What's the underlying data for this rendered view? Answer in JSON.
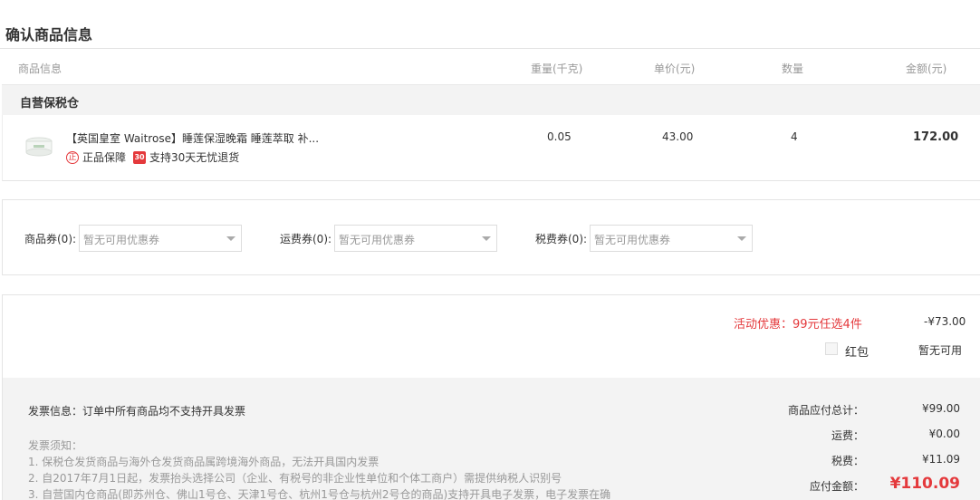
{
  "page": {
    "title": "确认商品信息"
  },
  "table": {
    "headers": {
      "info": "商品信息",
      "weight": "重量(千克)",
      "price": "单价(元)",
      "qty": "数量",
      "amount": "金额(元)"
    },
    "warehouse": "自营保税仓",
    "product": {
      "name": "【英国皇室 Waitrose】睡莲保湿晚霜 睡莲萃取 补...",
      "guarantee": "正品保障",
      "return_badge": "30",
      "return_policy": "支持30天无忧退货",
      "weight": "0.05",
      "price": "43.00",
      "qty": "4",
      "amount": "172.00"
    }
  },
  "coupons": {
    "goods": {
      "label": "商品券(0):",
      "placeholder": "暂无可用优惠券"
    },
    "shipping": {
      "label": "运费券(0):",
      "placeholder": "暂无可用优惠券"
    },
    "tax": {
      "label": "税费券(0):",
      "placeholder": "暂无可用优惠券"
    }
  },
  "discounts": {
    "promo_label": "活动优惠：99元任选4件",
    "promo_value": "-¥73.00",
    "redpacket_label": "红包",
    "redpacket_value": "暂无可用"
  },
  "invoice": {
    "info": "发票信息：订单中所有商品均不支持开具发票",
    "notice_title": "发票须知：",
    "notices": [
      "1. 保税仓发货商品与海外仓发货商品属跨境海外商品，无法开具国内发票",
      "2. 自2017年7月1日起，发票抬头选择公司（企业、有税号的非企业性单位和个体工商户）需提供纳税人识别号",
      "3. 自营国内仓商品(即苏州仓、佛山1号仓、天津1号仓、杭州1号仓与杭州2号仓的商品)支持开具电子发票，电子发票在确"
    ]
  },
  "summary": {
    "goods_total_label": "商品应付总计：",
    "goods_total": "¥99.00",
    "shipping_label": "运费：",
    "shipping": "¥0.00",
    "tax_label": "税费：",
    "tax": "¥11.09",
    "payable_label": "应付金额：",
    "payable": "¥110.09"
  },
  "colors": {
    "accent": "#e4393c",
    "muted": "#999999",
    "panel": "#f3f3f3"
  }
}
